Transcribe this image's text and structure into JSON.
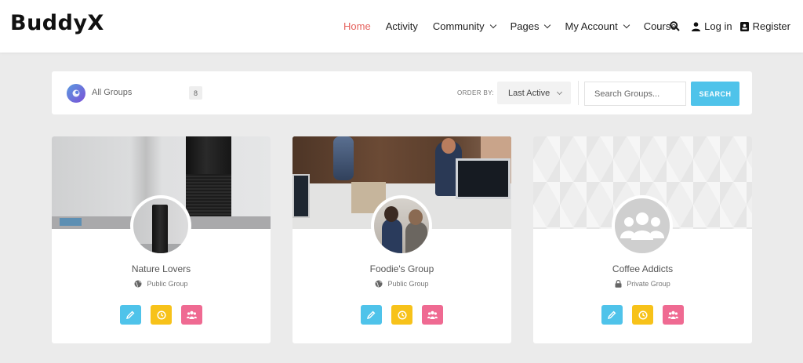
{
  "brand": {
    "logo_text": "BuddyX"
  },
  "nav": {
    "items": [
      {
        "label": "Home",
        "active": true,
        "has_dropdown": false
      },
      {
        "label": "Activity",
        "active": false,
        "has_dropdown": false
      },
      {
        "label": "Community",
        "active": false,
        "has_dropdown": true
      },
      {
        "label": "Pages",
        "active": false,
        "has_dropdown": true
      },
      {
        "label": "My Account",
        "active": false,
        "has_dropdown": true
      },
      {
        "label": "Course",
        "active": false,
        "has_dropdown": false
      }
    ]
  },
  "header_actions": {
    "search_icon": "search-icon",
    "login_label": "Log in",
    "register_label": "Register"
  },
  "toolbar": {
    "all_groups_label": "All Groups",
    "groups_count": "8",
    "order_by_label": "ORDER BY:",
    "order_by_value": "Last Active",
    "search_placeholder": "Search Groups...",
    "search_button": "SEARCH"
  },
  "groups": [
    {
      "name": "Nature Lovers",
      "type": "Public Group",
      "type_icon": "globe-icon"
    },
    {
      "name": "Foodie's Group",
      "type": "Public Group",
      "type_icon": "globe-icon"
    },
    {
      "name": "Coffee Addicts",
      "type": "Private Group",
      "type_icon": "lock-icon"
    }
  ],
  "colors": {
    "accent_active_nav": "#e5625d",
    "search_button": "#4fc3ea",
    "action_blue": "#4fc3ea",
    "action_yellow": "#f7c21a",
    "action_pink": "#ef6a92",
    "background": "#ebebeb"
  }
}
